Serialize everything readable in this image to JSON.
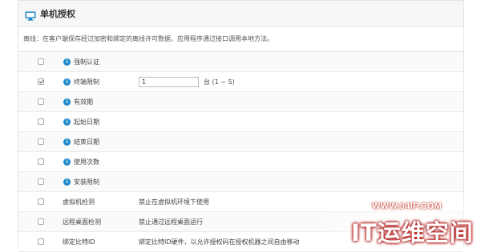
{
  "panel": {
    "title": "单机授权",
    "description": "离线：在客户端保存经过加密和绑定的离线许可数据，应用程序通过接口调用本地方法。"
  },
  "rows": [
    {
      "checked": false,
      "info": true,
      "label": "强制认证",
      "input_value": "",
      "value_text": ""
    },
    {
      "checked": true,
      "info": true,
      "label": "终端限制",
      "input_value": "1",
      "value_text": "台 (1 ~ 5)"
    },
    {
      "checked": false,
      "info": true,
      "label": "有效期",
      "input_value": "",
      "value_text": ""
    },
    {
      "checked": false,
      "info": true,
      "label": "起始日期",
      "input_value": "",
      "value_text": ""
    },
    {
      "checked": false,
      "info": true,
      "label": "结束日期",
      "input_value": "",
      "value_text": ""
    },
    {
      "checked": false,
      "info": true,
      "label": "使用次数",
      "input_value": "",
      "value_text": ""
    },
    {
      "checked": false,
      "info": true,
      "label": "安装限制",
      "input_value": "",
      "value_text": ""
    },
    {
      "checked": false,
      "info": false,
      "label": "虚拟机检测",
      "input_value": "",
      "value_text": "禁止在虚拟机环境下使用"
    },
    {
      "checked": false,
      "info": false,
      "label": "远程桌面检测",
      "input_value": "",
      "value_text": "禁止通过远程桌面运行"
    },
    {
      "checked": false,
      "info": false,
      "label": "绑定比特ID",
      "input_value": "",
      "value_text": "绑定比特ID硬件，以允许授权码在授权机器之间自由移动"
    }
  ],
  "watermark": {
    "domain": "WWW.94IP.COM",
    "brand": "IT运维空间"
  },
  "colors": {
    "info_icon": "#1e88c8",
    "header_bg": "#f7f7f7",
    "monitor_icon": "#1e88c8"
  }
}
